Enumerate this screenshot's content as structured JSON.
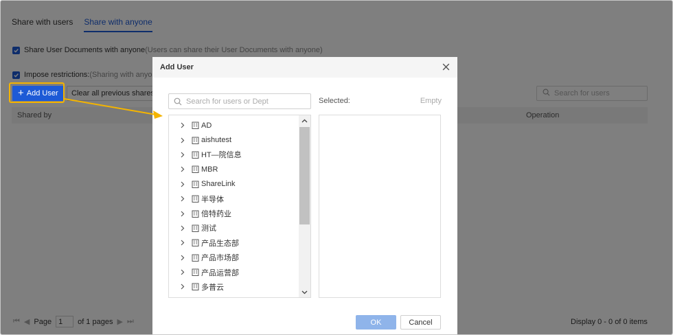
{
  "tabs": [
    {
      "label": "Share with users",
      "active": false
    },
    {
      "label": "Share with anyone",
      "active": true
    }
  ],
  "options": {
    "share_docs": {
      "label": "Share User Documents with anyone",
      "hint": "(Users can share their User Documents with anyone)",
      "checked": true
    },
    "restrictions": {
      "label": "Impose restrictions:",
      "hint": "(Sharing with anyone",
      "checked": true
    }
  },
  "toolbar": {
    "add_user_label": "Add User",
    "clear_label": "Clear all previous shares",
    "search_placeholder": "Search for users"
  },
  "table": {
    "columns": [
      "Shared by",
      "Operation"
    ]
  },
  "pager": {
    "page_label": "Page",
    "page_value": "1",
    "of_label": "of 1 pages",
    "display_info": "Display 0 - 0 of 0 items"
  },
  "dialog": {
    "title": "Add User",
    "search_placeholder": "Search for users or Dept",
    "selected_label": "Selected:",
    "empty_label": "Empty",
    "tree_items": [
      "AD",
      "aishutest",
      "HT—院信息",
      "MBR",
      "ShareLink",
      "半导体",
      "倍特药业",
      "测试",
      "产品生态部",
      "产品市场部",
      "产品运营部",
      "多普云"
    ],
    "ok_label": "OK",
    "cancel_label": "Cancel"
  },
  "colors": {
    "primary": "#1d5ad6",
    "highlight": "#f4b400",
    "ok_disabled": "#8fb4ea"
  },
  "icons": [
    "check-icon",
    "plus-icon",
    "search-icon",
    "close-icon",
    "chevron-right-icon",
    "building-icon",
    "scroll-up-icon",
    "scroll-down-icon",
    "first-page-icon",
    "prev-page-icon",
    "next-page-icon",
    "last-page-icon"
  ]
}
